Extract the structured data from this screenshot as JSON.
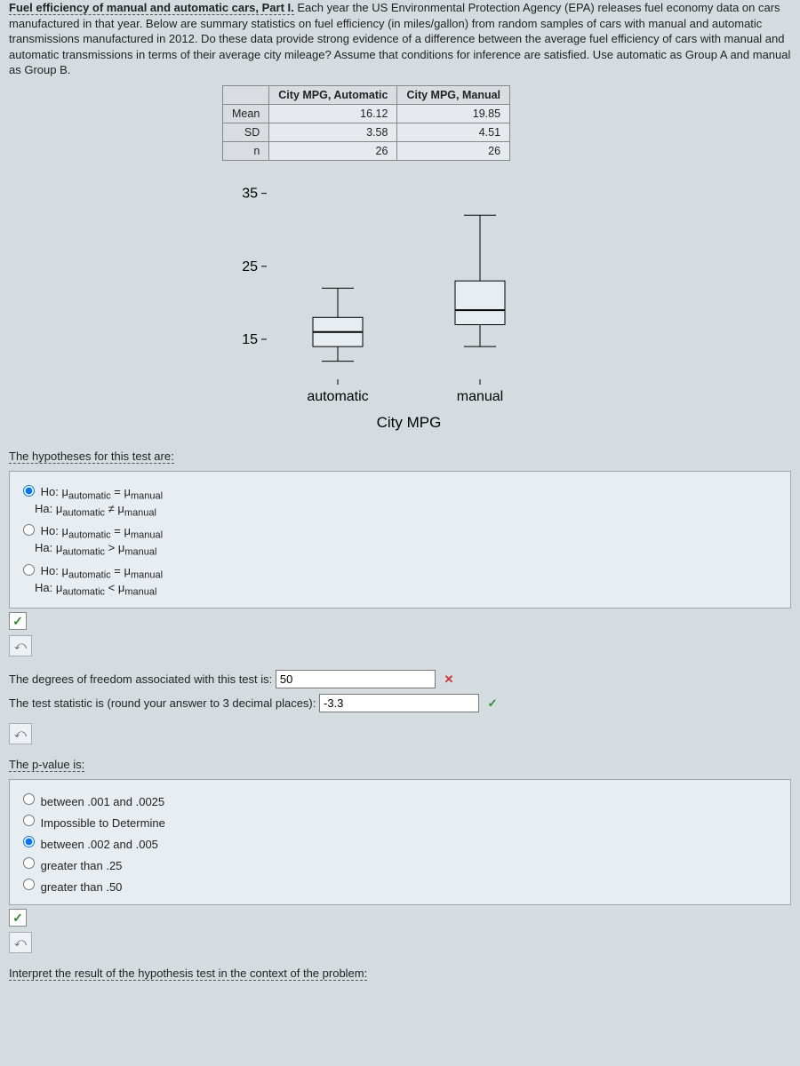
{
  "intro": {
    "lead": "Fuel efficiency of manual and automatic cars, Part I.",
    "body": "Each year the US Environmental Protection Agency (EPA) releases fuel economy data on cars manufactured in that year. Below are summary statistics on fuel efficiency (in miles/gallon) from random samples of cars with manual and automatic transmissions manufactured in 2012. Do these data provide strong evidence of a difference between the average fuel efficiency of cars with manual and automatic transmissions in terms of their average city mileage? Assume that conditions for inference are satisfied. Use automatic as Group A and manual as Group B."
  },
  "table": {
    "col1": "City MPG, Automatic",
    "col2": "City MPG, Manual",
    "rows": [
      {
        "h": "Mean",
        "a": "16.12",
        "b": "19.85"
      },
      {
        "h": "SD",
        "a": "3.58",
        "b": "4.51"
      },
      {
        "h": "n",
        "a": "26",
        "b": "26"
      }
    ]
  },
  "chart_data": {
    "type": "boxplot",
    "title": "",
    "xlabel": "City MPG",
    "ylabel": "",
    "yticks": [
      15,
      25,
      35
    ],
    "ylim": [
      10,
      38
    ],
    "categories": [
      "automatic",
      "manual"
    ],
    "series": [
      {
        "name": "automatic",
        "min": 12,
        "q1": 14,
        "median": 16,
        "q3": 18,
        "max": 22
      },
      {
        "name": "manual",
        "min": 14,
        "q1": 17,
        "median": 19,
        "q3": 23,
        "max": 32
      }
    ]
  },
  "q_hypotheses": {
    "label": "The hypotheses for this test are:",
    "opts": [
      {
        "h0": "Ho: μautomatic = μmanual",
        "ha": "Ha: μautomatic ≠ μmanual",
        "sel": true
      },
      {
        "h0": "Ho: μautomatic = μmanual",
        "ha": "Ha: μautomatic > μmanual",
        "sel": false
      },
      {
        "h0": "Ho: μautomatic = μmanual",
        "ha": "Ha: μautomatic < μmanual",
        "sel": false
      }
    ]
  },
  "q_num": {
    "df_label": "The degrees of freedom associated with this test is:",
    "df_value": "50",
    "df_correct": false,
    "ts_label": "The test statistic is (round your answer to 3 decimal places):",
    "ts_value": "-3.3",
    "ts_correct": true
  },
  "q_pvalue": {
    "label": "The p-value is:",
    "opts": [
      {
        "t": "between .001 and .0025",
        "sel": false
      },
      {
        "t": "Impossible to Determine",
        "sel": false
      },
      {
        "t": "between .002 and .005",
        "sel": true
      },
      {
        "t": "greater than .25",
        "sel": false
      },
      {
        "t": "greater than .50",
        "sel": false
      }
    ]
  },
  "q_interpret": {
    "label": "Interpret the result of the hypothesis test in the context of the problem:"
  },
  "icons": {
    "retry": "⤺",
    "check": "✓"
  }
}
